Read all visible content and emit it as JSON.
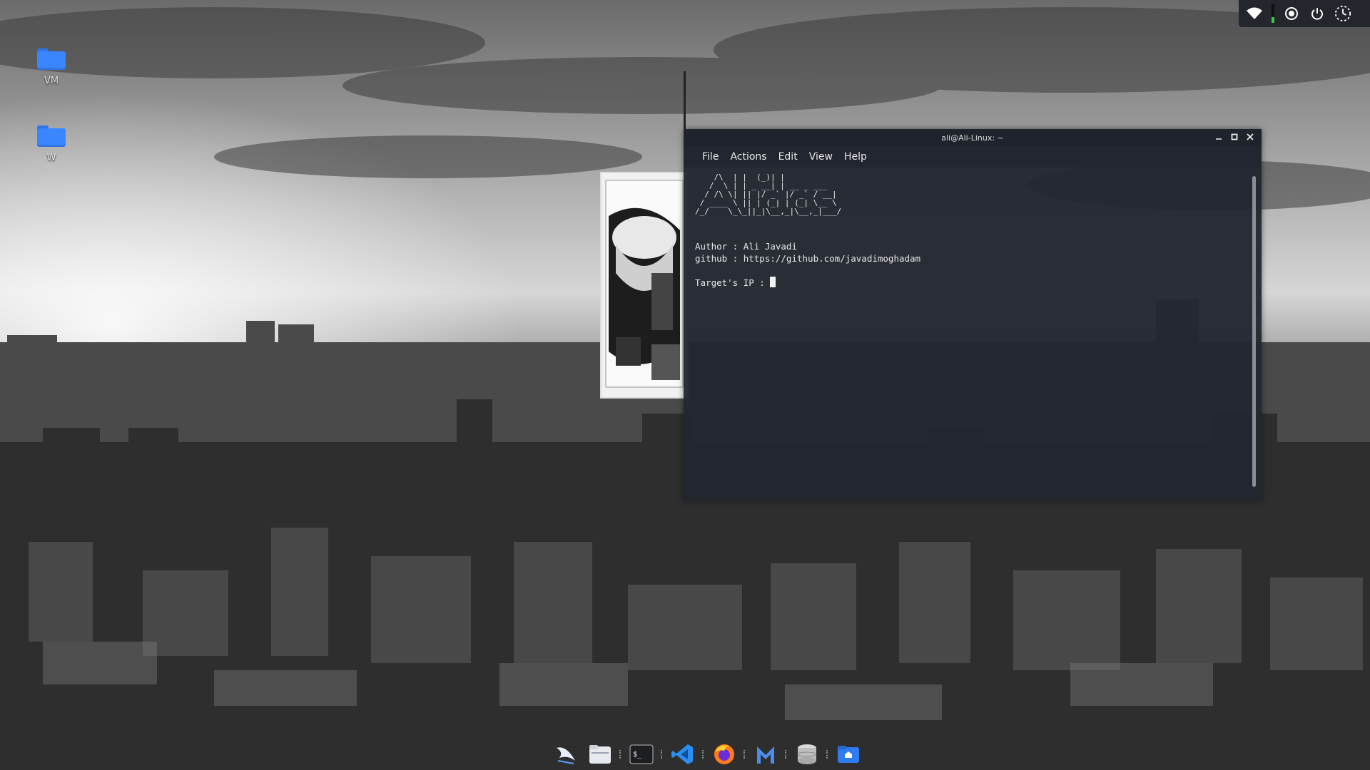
{
  "desktop": {
    "icons": [
      {
        "label": "VM"
      },
      {
        "label": "W"
      }
    ]
  },
  "tray": {
    "icons": [
      "wifi-icon",
      "memory-meter",
      "record-icon",
      "power-icon",
      "clock-icon"
    ],
    "meter_level_fraction": 0.3
  },
  "terminal": {
    "title": "ali@Ali-Linux: ~",
    "menu": [
      "File",
      "Actions",
      "Edit",
      "View",
      "Help"
    ],
    "ascii_art": "    /\\  | |  (_)| |           \n   /  \\ | | _ __| | __ _ ___ \n  / /\\ \\| || |/ _` |/ _` / __|\n / ____ \\ || | (_| | (_| \\__ \\\n/_/    \\_\\_||_|\\__,_|\\__,_|___/",
    "lines": [
      "Author : Ali Javadi",
      "github : https://github.com/javadimoghadam",
      "",
      "Target's IP : "
    ]
  },
  "dock": {
    "items": [
      "kali-dragon-icon",
      "files-icon",
      "terminal-icon",
      "vscode-icon",
      "firefox-icon",
      "maltego-icon",
      "database-icon",
      "home-folder-icon"
    ]
  },
  "colors": {
    "terminal_bg": "#222630",
    "folder_blue": "#3a86ff",
    "tray_bg": "#23262c"
  }
}
